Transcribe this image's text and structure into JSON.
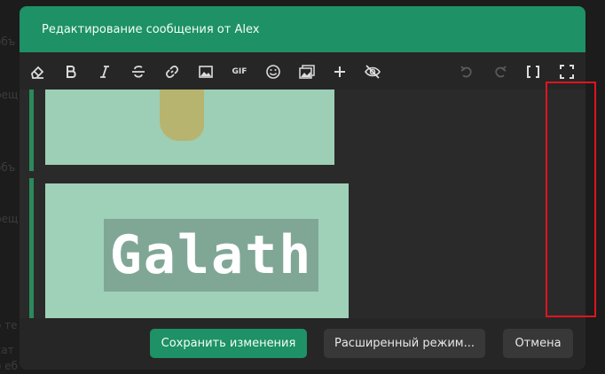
{
  "modal": {
    "title": "Редактирование сообщения от Alex"
  },
  "toolbar": {
    "buttons": [
      "eraser-icon",
      "bold-icon",
      "italic-icon",
      "strikethrough-icon",
      "link-icon",
      "image-icon",
      "gif-icon",
      "emoji-icon",
      "gallery-icon",
      "plus-icon",
      "hide-icon",
      "undo-icon",
      "redo-icon",
      "bbcode-icon",
      "fullscreen-icon"
    ],
    "gif_label": "GIF"
  },
  "editor": {
    "image_text": "Galath"
  },
  "footer": {
    "save_label": "Сохранить изменения",
    "advanced_label": "Расширенный режим...",
    "cancel_label": "Отмена"
  },
  "colors": {
    "accent": "#1e9166",
    "highlight": "#e0141f",
    "background": "#262626"
  }
}
